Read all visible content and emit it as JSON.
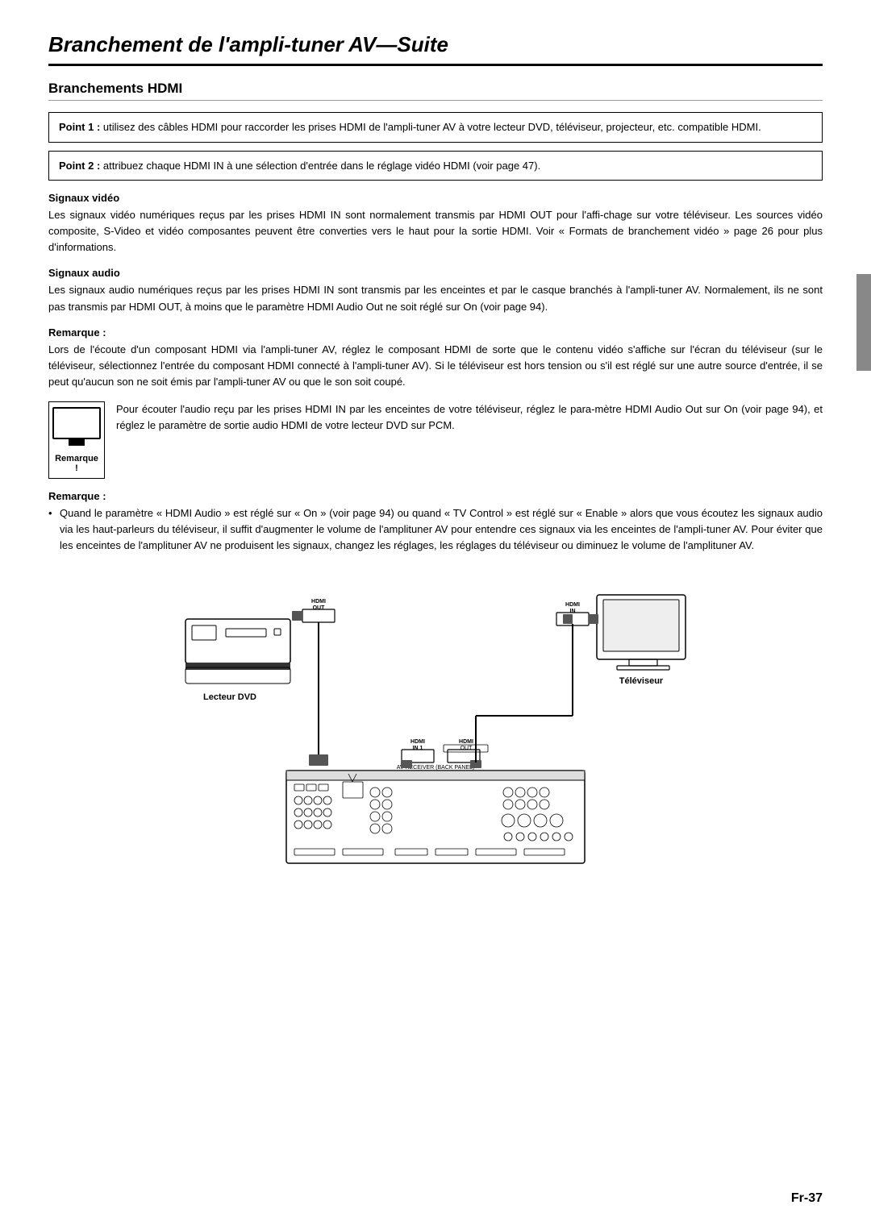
{
  "page": {
    "title_normal": "Branchement de l'ampli-tuner AV",
    "title_italic": "Suite",
    "section_title": "Branchements HDMI",
    "point1": {
      "label": "Point 1 :",
      "text": "utilisez des câbles HDMI pour raccorder les prises HDMI de l'ampli-tuner AV à votre lecteur DVD, téléviseur, projecteur, etc. compatible HDMI."
    },
    "point2": {
      "label": "Point 2 :",
      "text": "attribuez chaque HDMI IN à une sélection d'entrée dans le réglage vidéo HDMI (voir page 47)."
    },
    "signaux_video": {
      "heading": "Signaux vidéo",
      "text": "Les signaux vidéo numériques reçus par les prises HDMI IN sont normalement transmis par HDMI OUT pour l'affi-chage sur votre téléviseur. Les sources vidéo composite, S-Video et vidéo composantes peuvent être converties vers le haut pour la sortie HDMI. Voir « Formats de branchement vidéo » page 26 pour plus d'informations."
    },
    "signaux_audio": {
      "heading": "Signaux audio",
      "text": "Les signaux audio numériques reçus par les prises HDMI IN sont transmis par les enceintes et par le casque branchés à l'ampli-tuner AV. Normalement, ils ne sont pas transmis par HDMI OUT, à moins que le paramètre HDMI Audio Out ne soit réglé sur On (voir page 94)."
    },
    "remarque1": {
      "heading": "Remarque :",
      "text": "Lors de l'écoute d'un composant HDMI via l'ampli-tuner AV, réglez le composant HDMI de sorte que le contenu vidéo s'affiche sur l'écran du téléviseur (sur le téléviseur, sélectionnez l'entrée du composant HDMI connecté à l'ampli-tuner AV). Si le téléviseur est hors tension ou s'il est réglé sur une autre source d'entrée, il se peut qu'aucun son ne soit émis par l'ampli-tuner AV ou que le son soit coupé."
    },
    "remarque_inline": {
      "box_label": "Remarque !",
      "text": "Pour écouter l'audio reçu par les prises HDMI IN par les enceintes de votre téléviseur, réglez le para-mètre HDMI Audio Out sur On (voir page 94), et réglez le paramètre de sortie audio HDMI de votre lecteur DVD sur PCM."
    },
    "remarque2": {
      "heading": "Remarque :",
      "bullet": "Quand le paramètre « HDMI Audio »  est réglé sur « On »  (voir page 94) ou quand « TV Control »  est réglé sur « Enable »  alors que vous écoutez les signaux audio via les haut-parleurs du téléviseur, il suffit d'augmenter le volume de l'amplituner AV pour entendre ces signaux via les enceintes de l'ampli-tuner AV. Pour éviter que les enceintes de l'amplituner AV ne produisent les signaux, changez les réglages, les réglages du téléviseur ou diminuez le volume de l'amplituner AV."
    },
    "diagram": {
      "lecteur_dvd_label": "Lecteur DVD",
      "televiseur_label": "Téléviseur",
      "hdmi_out_label": "HDMI OUT",
      "hdmi_in_label": "HDMI IN",
      "hdmi_in1_label": "HDMI IN 1",
      "hdmi_out2_label": "HDMI OUT"
    },
    "page_number": "Fr-37",
    "on_text": "On"
  }
}
